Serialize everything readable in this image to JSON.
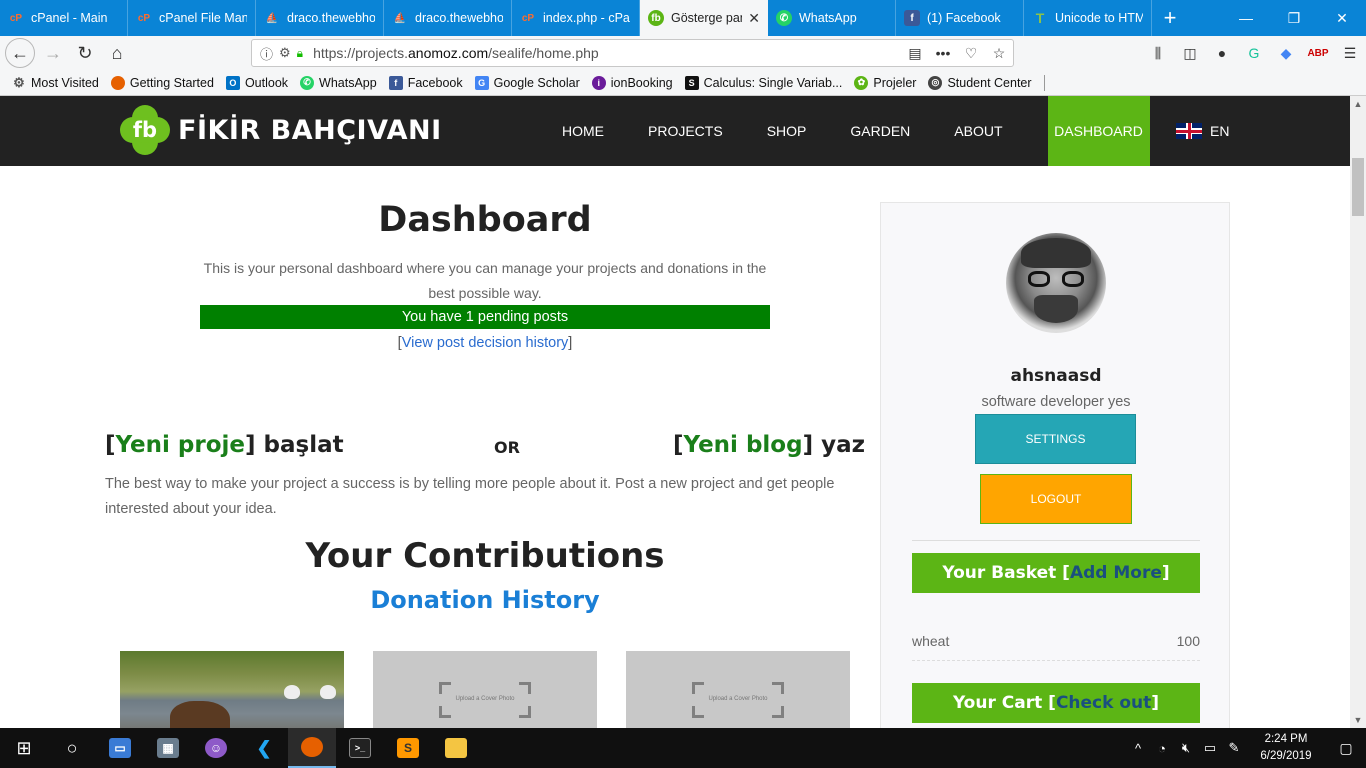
{
  "browser": {
    "tabs": [
      {
        "title": "cPanel - Main",
        "icon": "cpanel-icon",
        "color": "#ff6c2c"
      },
      {
        "title": "cPanel File Mana",
        "icon": "cpanel-icon",
        "color": "#ff6c2c"
      },
      {
        "title": "draco.thewebho",
        "icon": "ship-icon",
        "color": "#d48a2c"
      },
      {
        "title": "draco.thewebho",
        "icon": "ship-icon",
        "color": "#d48a2c"
      },
      {
        "title": "index.php - cPa",
        "icon": "cpanel-icon",
        "color": "#ff6c2c"
      },
      {
        "title": "Gösterge pan",
        "icon": "fb-gear-icon",
        "color": "#5cb515",
        "active": true
      },
      {
        "title": "WhatsApp",
        "icon": "whatsapp-icon",
        "color": "#25d366"
      },
      {
        "title": "(1) Facebook",
        "icon": "facebook-icon",
        "color": "#3b5998"
      },
      {
        "title": "Unicode to HTM",
        "icon": "t-icon",
        "color": "#8bc34a"
      }
    ],
    "new_tab": "+",
    "url_prefix": "https://projects.",
    "url_domain": "anomoz.com",
    "url_suffix": "/sealife/home.php",
    "bookmarks": [
      {
        "label": "Most Visited",
        "icon": "gear-icon",
        "color": "#555"
      },
      {
        "label": "Getting Started",
        "icon": "firefox-icon",
        "color": "#e66000"
      },
      {
        "label": "Outlook",
        "icon": "outlook-icon",
        "color": "#0072c6"
      },
      {
        "label": "WhatsApp",
        "icon": "whatsapp-icon",
        "color": "#25d366"
      },
      {
        "label": "Facebook",
        "icon": "facebook-icon",
        "color": "#3b5998"
      },
      {
        "label": "Google Scholar",
        "icon": "scholar-icon",
        "color": "#4285f4"
      },
      {
        "label": "ionBooking",
        "icon": "ion-icon",
        "color": "#6a1b9a"
      },
      {
        "label": "Calculus: Single Variab...",
        "icon": "s-icon",
        "color": "#111"
      },
      {
        "label": "Projeler",
        "icon": "fb-gear-icon",
        "color": "#5cb515"
      },
      {
        "label": "Student Center",
        "icon": "globe-icon",
        "color": "#444"
      }
    ]
  },
  "site": {
    "logo_text": "FİKİR BAHÇIVANI",
    "logo_mark": "fb",
    "menu": [
      "HOME",
      "PROJECTS",
      "SHOP",
      "GARDEN",
      "ABOUT",
      "DASHBOARD"
    ],
    "lang": "EN"
  },
  "dashboard": {
    "title": "Dashboard",
    "description": "This is your personal dashboard where you can manage your projects and donations in the best possible way.",
    "pending": "You have 1 pending posts",
    "history_link": "View post decision history",
    "start_project_link": "Yeni proje",
    "start_project_suffix": "başlat",
    "or": "OR",
    "write_blog_link": "Yeni blog",
    "write_blog_suffix": "yaz",
    "start_desc": "The best way to make your project a success is by telling more people about it. Post a new project and get people interested about your idea.",
    "contributions_title": "Your Contributions",
    "donation_history": "Donation History",
    "cover_placeholder": "Upload a Cover Photo"
  },
  "profile": {
    "name": "ahsnaasd",
    "title": "software developer yes",
    "settings": "SETTINGS",
    "logout": "LOGOUT",
    "basket_title": "Your Basket",
    "basket_link": "Add More",
    "basket_items": [
      {
        "name": "wheat",
        "qty": "100"
      }
    ],
    "cart_title": "Your Cart",
    "cart_link": "Check out"
  },
  "taskbar": {
    "time": "2:24 PM",
    "date": "6/29/2019"
  }
}
